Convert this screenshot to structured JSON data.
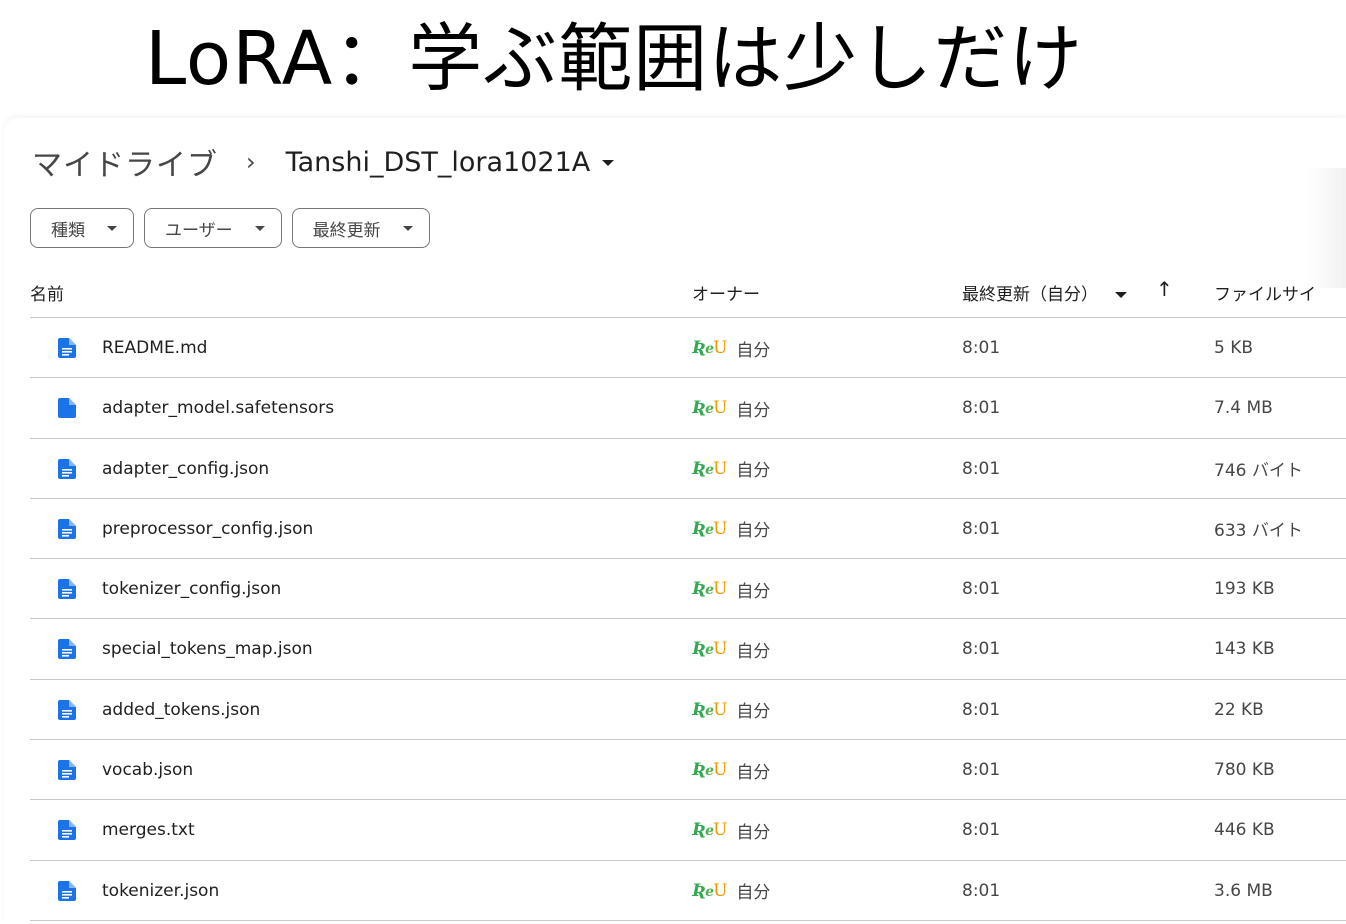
{
  "slide_title": "LoRA：学ぶ範囲は少しだけ",
  "breadcrumb": {
    "root": "マイドライブ",
    "separator": "›",
    "current": "Tanshi_DST_lora1021A"
  },
  "filters": [
    {
      "label": "種類"
    },
    {
      "label": "ユーザー"
    },
    {
      "label": "最終更新"
    }
  ],
  "columns": {
    "name": "名前",
    "owner": "オーナー",
    "modified": "最終更新（自分）",
    "size": "ファイルサイ"
  },
  "sort_arrow": "↑",
  "owner_logo": {
    "part1": "Ʀ",
    "part2": "e",
    "part3": "U"
  },
  "accent_color": "#1a73e8",
  "files": [
    {
      "name": "README.md",
      "owner": "自分",
      "modified": "8:01",
      "size": "5 KB",
      "icon": "document-icon"
    },
    {
      "name": "adapter_model.safetensors",
      "owner": "自分",
      "modified": "8:01",
      "size": "7.4 MB",
      "icon": "file-icon"
    },
    {
      "name": "adapter_config.json",
      "owner": "自分",
      "modified": "8:01",
      "size": "746 バイト",
      "icon": "document-icon"
    },
    {
      "name": "preprocessor_config.json",
      "owner": "自分",
      "modified": "8:01",
      "size": "633 バイト",
      "icon": "document-icon"
    },
    {
      "name": "tokenizer_config.json",
      "owner": "自分",
      "modified": "8:01",
      "size": "193 KB",
      "icon": "document-icon"
    },
    {
      "name": "special_tokens_map.json",
      "owner": "自分",
      "modified": "8:01",
      "size": "143 KB",
      "icon": "document-icon"
    },
    {
      "name": "added_tokens.json",
      "owner": "自分",
      "modified": "8:01",
      "size": "22 KB",
      "icon": "document-icon"
    },
    {
      "name": "vocab.json",
      "owner": "自分",
      "modified": "8:01",
      "size": "780 KB",
      "icon": "document-icon"
    },
    {
      "name": "merges.txt",
      "owner": "自分",
      "modified": "8:01",
      "size": "446 KB",
      "icon": "document-icon"
    },
    {
      "name": "tokenizer.json",
      "owner": "自分",
      "modified": "8:01",
      "size": "3.6 MB",
      "icon": "document-icon"
    }
  ]
}
